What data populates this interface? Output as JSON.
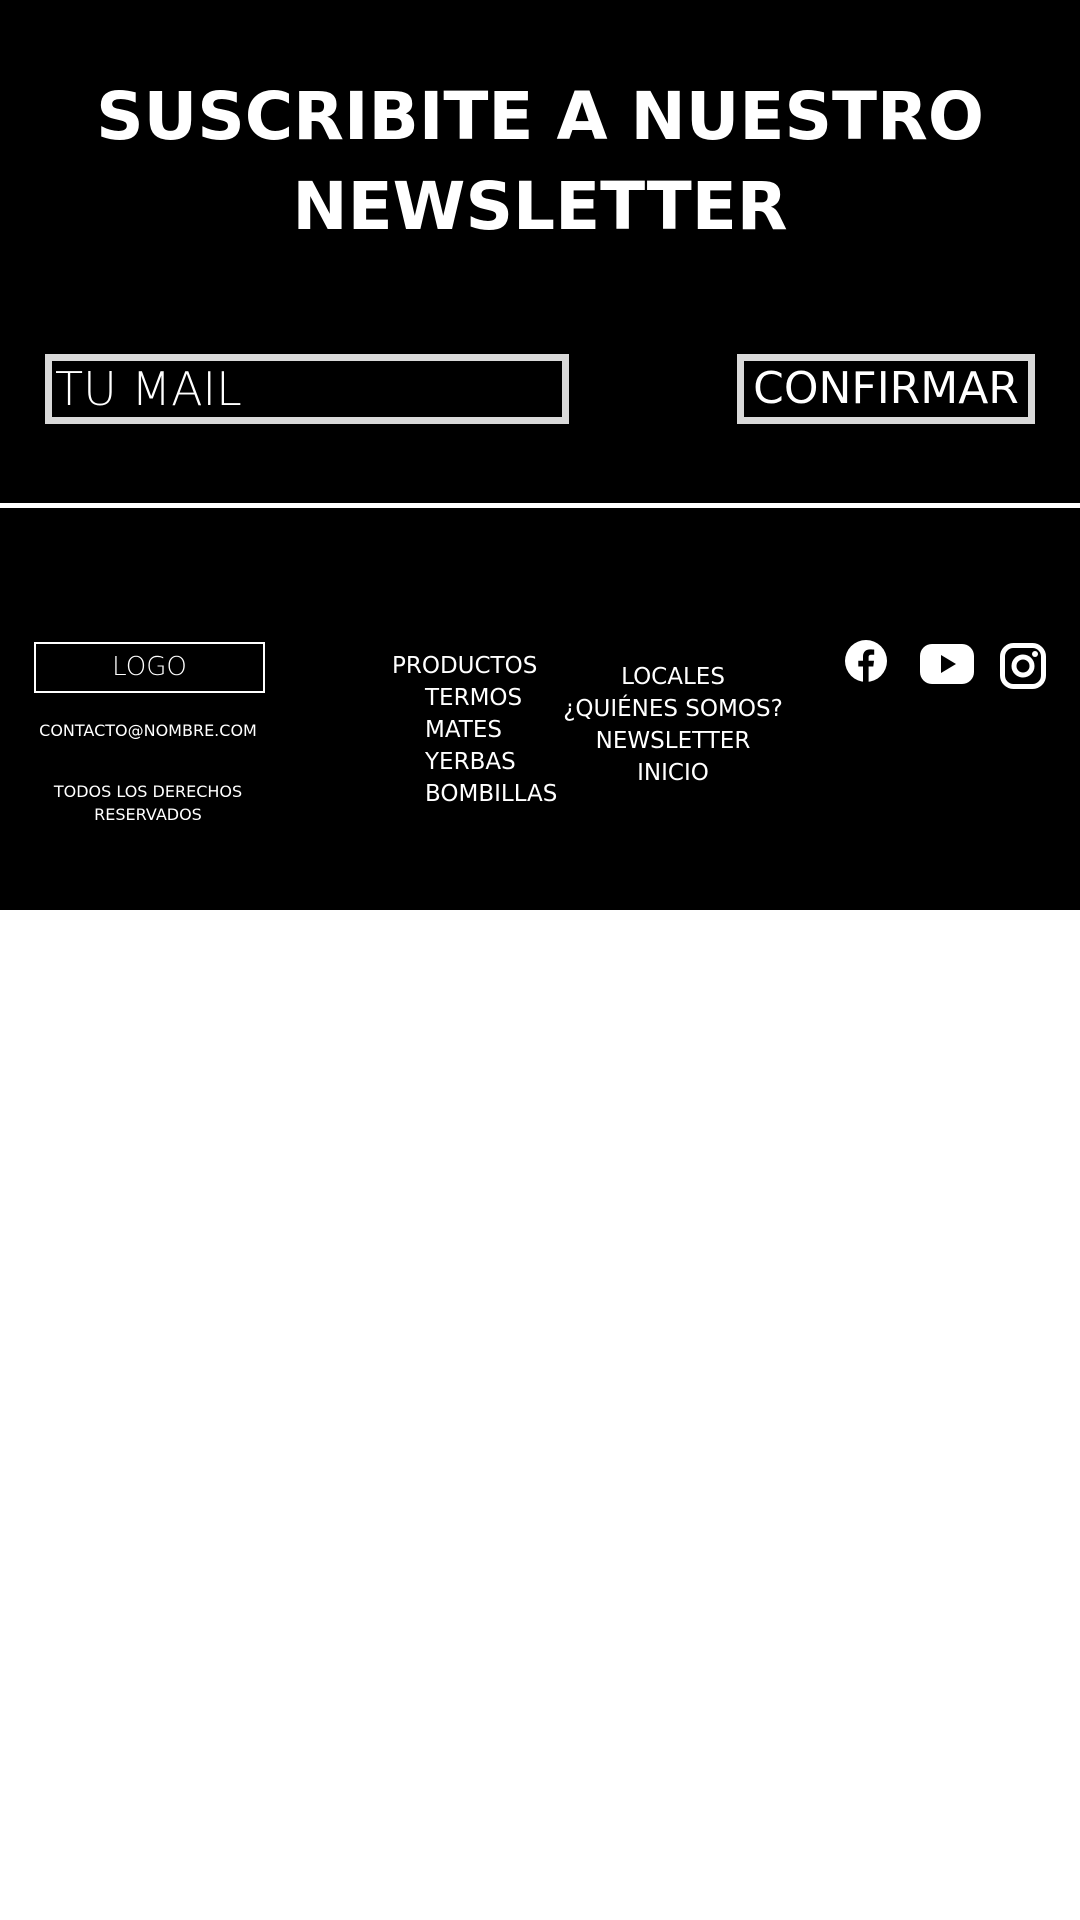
{
  "newsletter": {
    "title_line1": "SUSCRIBITE A NUESTRO",
    "title_line2": "NEWSLETTER",
    "email_placeholder": "TU MAIL",
    "confirm_label": "CONFIRMAR"
  },
  "footer": {
    "logo_label": "LOGO",
    "contact_email": "CONTACTO@NOMBRE.COM",
    "rights_line1": "TODOS LOS DERECHOS",
    "rights_line2": "RESERVADOS",
    "nav_products": {
      "heading": "PRODUCTOS",
      "items": [
        "TERMOS",
        "MATES",
        "YERBAS",
        "BOMBILLAS"
      ]
    },
    "nav_other": [
      "LOCALES",
      "¿QUIÉNES SOMOS?",
      "NEWSLETTER",
      "INICIO"
    ],
    "social_icons": [
      "facebook-icon",
      "youtube-icon",
      "instagram-icon"
    ]
  },
  "colors": {
    "background": "#000000",
    "text": "#ffffff",
    "input_border": "#d9d9d9",
    "page_background": "#ffffff"
  }
}
